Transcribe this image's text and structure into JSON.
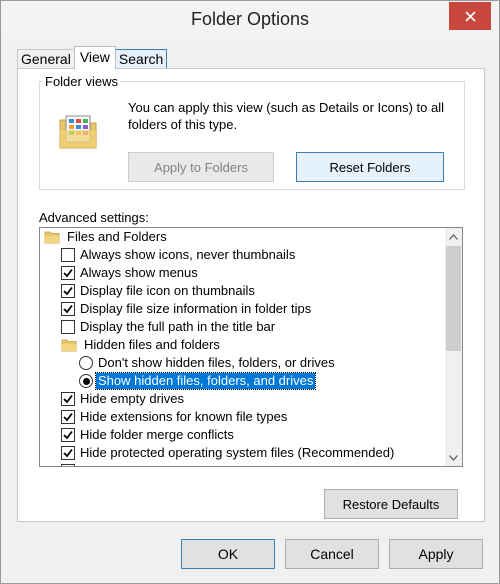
{
  "window": {
    "title": "Folder Options",
    "close_icon": "close-icon"
  },
  "tabs": [
    {
      "label": "General",
      "active": false
    },
    {
      "label": "View",
      "active": true
    },
    {
      "label": "Search",
      "active": false
    }
  ],
  "folder_views": {
    "legend": "Folder views",
    "icon": "folder-views-icon",
    "description": "You can apply this view (such as Details or Icons) to all folders of this type.",
    "apply_label": "Apply to Folders",
    "reset_label": "Reset Folders"
  },
  "advanced": {
    "label": "Advanced settings:",
    "items": [
      {
        "type": "folder",
        "label": "Files and Folders",
        "indent": 0
      },
      {
        "type": "checkbox",
        "label": "Always show icons, never thumbnails",
        "checked": false,
        "indent": 1
      },
      {
        "type": "checkbox",
        "label": "Always show menus",
        "checked": true,
        "indent": 1
      },
      {
        "type": "checkbox",
        "label": "Display file icon on thumbnails",
        "checked": true,
        "indent": 1
      },
      {
        "type": "checkbox",
        "label": "Display file size information in folder tips",
        "checked": true,
        "indent": 1
      },
      {
        "type": "checkbox",
        "label": "Display the full path in the title bar",
        "checked": false,
        "indent": 1
      },
      {
        "type": "folder",
        "label": "Hidden files and folders",
        "indent": 1
      },
      {
        "type": "radio",
        "label": "Don't show hidden files, folders, or drives",
        "checked": false,
        "indent": 2
      },
      {
        "type": "radio",
        "label": "Show hidden files, folders, and drives",
        "checked": true,
        "selected": true,
        "indent": 2
      },
      {
        "type": "checkbox",
        "label": "Hide empty drives",
        "checked": true,
        "indent": 1
      },
      {
        "type": "checkbox",
        "label": "Hide extensions for known file types",
        "checked": true,
        "indent": 1
      },
      {
        "type": "checkbox",
        "label": "Hide folder merge conflicts",
        "checked": true,
        "indent": 1
      },
      {
        "type": "checkbox",
        "label": "Hide protected operating system files (Recommended)",
        "checked": true,
        "indent": 1
      },
      {
        "type": "checkbox",
        "label": "",
        "checked": false,
        "indent": 1
      }
    ],
    "scroll_position": 0.0
  },
  "restore_label": "Restore Defaults",
  "footer": {
    "ok_label": "OK",
    "cancel_label": "Cancel",
    "apply_label": "Apply"
  },
  "colors": {
    "selection": "#0078d7",
    "close_button": "#c7463d",
    "default_button_border": "#3c7fb1"
  }
}
